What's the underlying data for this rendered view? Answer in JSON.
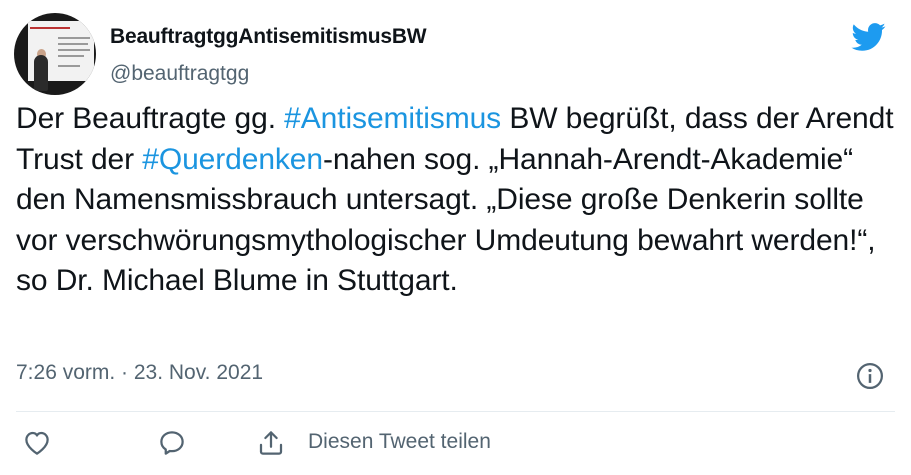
{
  "author": {
    "display_name": "BeauftragtggAntisemitismusBW",
    "handle": "@beauftragtgg"
  },
  "tweet": {
    "line1_a": "Der Beauftragte gg. ",
    "hashtag1": "#Antisemitismus",
    "line1_b": " BW begrüßt, dass der Arendt Trust der ",
    "hashtag2": "#Querdenken",
    "line2_b": "-nahen sog. „Hannah-Arendt-Akademie“ den Namensmissbrauch untersagt. „Diese große Denkerin sollte vor verschwörungsmythologischer Umdeutung bewahrt werden!“, so Dr. Michael Blume in Stuttgart."
  },
  "timestamp": "7:26 vorm. · 23. Nov. 2021",
  "actions": {
    "share_label": "Diesen Tweet teilen"
  },
  "icons": {
    "brand": "twitter-bird-icon",
    "info": "info-icon",
    "like": "heart-icon",
    "reply": "comment-icon",
    "share": "share-icon"
  },
  "colors": {
    "brand_blue": "#1d9bf0",
    "hashtag_blue": "#1b95e0",
    "secondary_text": "#536471",
    "primary_text": "#0f1419"
  }
}
